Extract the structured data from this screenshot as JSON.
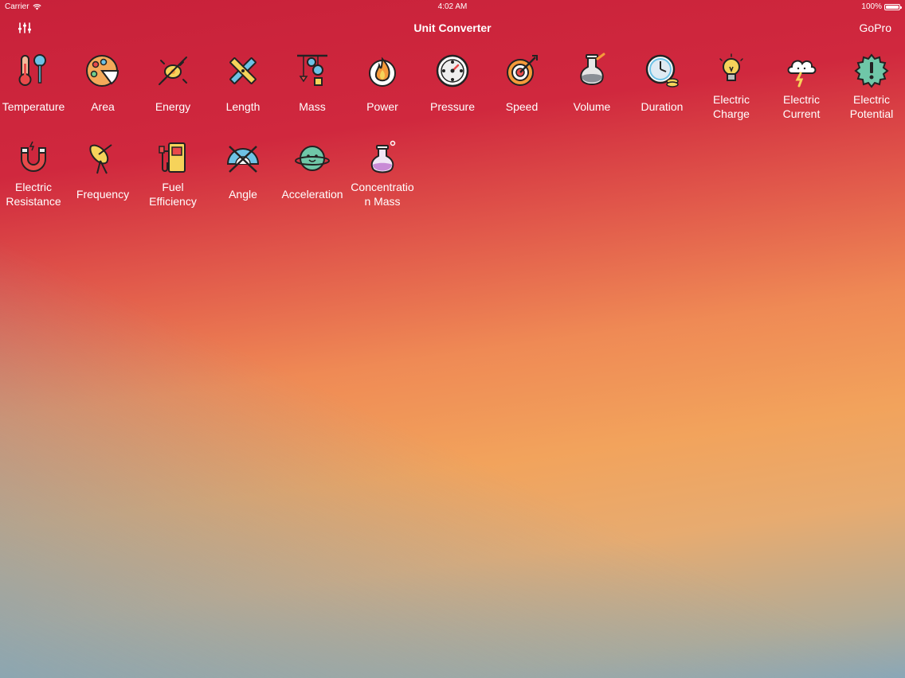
{
  "status": {
    "carrier": "Carrier",
    "time": "4:02 AM",
    "battery": "100%"
  },
  "nav": {
    "title": "Unit Converter",
    "right_button": "GoPro",
    "left_icon": "sliders-icon"
  },
  "categories": [
    {
      "label": "Temperature",
      "icon": "thermometer-icon"
    },
    {
      "label": "Area",
      "icon": "palette-area-icon"
    },
    {
      "label": "Energy",
      "icon": "energy-bug-icon"
    },
    {
      "label": "Length",
      "icon": "ruler-pencil-icon"
    },
    {
      "label": "Mass",
      "icon": "pulley-weights-icon"
    },
    {
      "label": "Power",
      "icon": "flame-icon"
    },
    {
      "label": "Pressure",
      "icon": "pressure-gauge-icon"
    },
    {
      "label": "Speed",
      "icon": "target-arrow-icon"
    },
    {
      "label": "Volume",
      "icon": "flask-icon"
    },
    {
      "label": "Duration",
      "icon": "clock-coins-icon"
    },
    {
      "label": "Electric Charge",
      "icon": "lightbulb-icon"
    },
    {
      "label": "Electric Current",
      "icon": "storm-cloud-icon"
    },
    {
      "label": "Electric Potential",
      "icon": "high-voltage-icon"
    },
    {
      "label": "Electric Resistance",
      "icon": "magnet-icon"
    },
    {
      "label": "Frequency",
      "icon": "satellite-dish-icon"
    },
    {
      "label": "Fuel Efficiency",
      "icon": "fuel-pump-icon"
    },
    {
      "label": "Angle",
      "icon": "protractor-icon"
    },
    {
      "label": "Acceleration",
      "icon": "planet-icon"
    },
    {
      "label": "Concentration Mass",
      "icon": "potion-flask-icon"
    }
  ],
  "label_lines": [
    [
      "Temperature"
    ],
    [
      "Area"
    ],
    [
      "Energy"
    ],
    [
      "Length"
    ],
    [
      "Mass"
    ],
    [
      "Power"
    ],
    [
      "Pressure"
    ],
    [
      "Speed"
    ],
    [
      "Volume"
    ],
    [
      "Duration"
    ],
    [
      "Electric",
      "Charge"
    ],
    [
      "Electric",
      "Current"
    ],
    [
      "Electric",
      "Potential"
    ],
    [
      "Electric",
      "Resistance"
    ],
    [
      "Frequency"
    ],
    [
      "Fuel",
      "Efficiency"
    ],
    [
      "Angle"
    ],
    [
      "Acceleration"
    ],
    [
      "Concentratio",
      "n Mass"
    ]
  ]
}
